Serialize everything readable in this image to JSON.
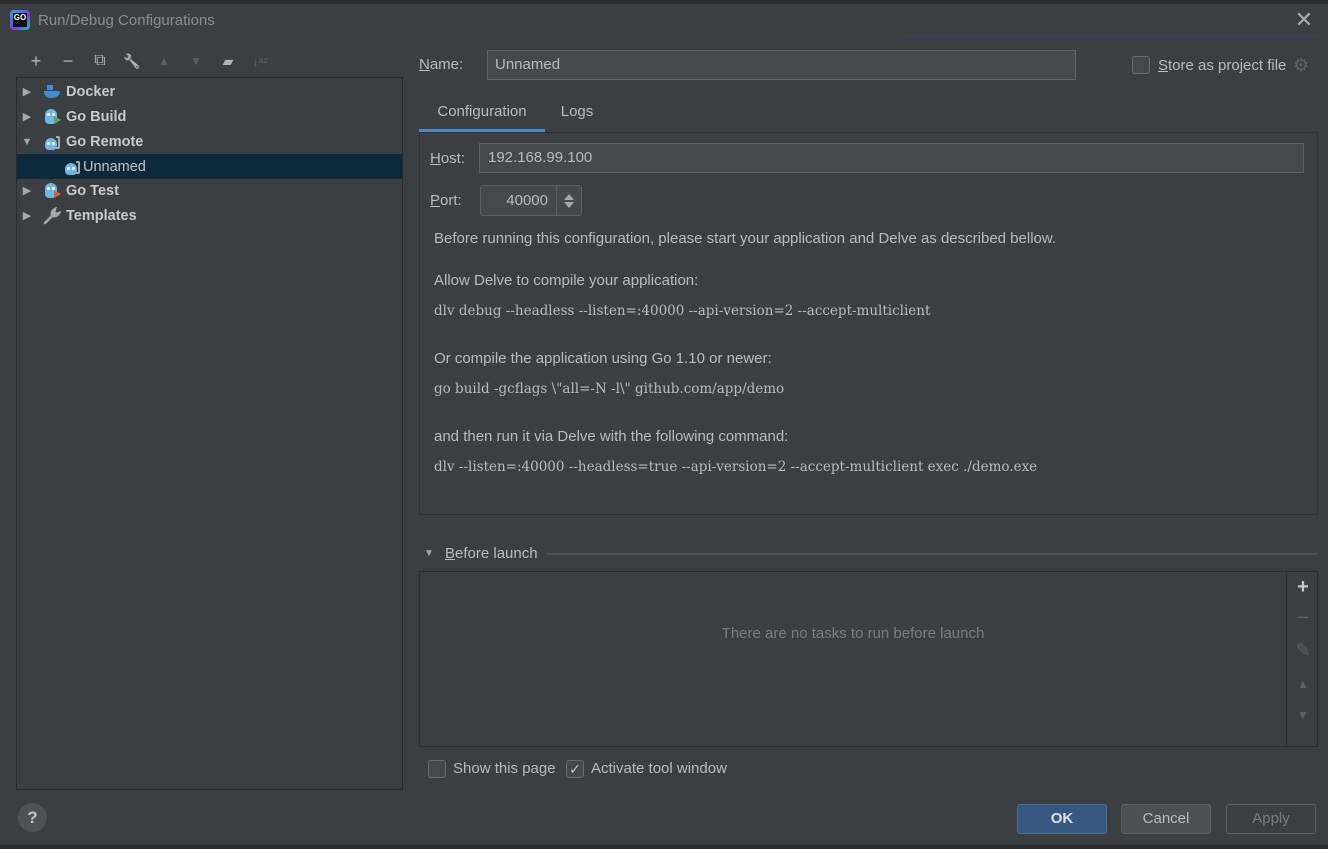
{
  "window": {
    "title": "Run/Debug Configurations",
    "app_icon": "goland-logo-icon",
    "close_icon": "close-icon"
  },
  "toolbar": {
    "buttons": [
      {
        "name": "add",
        "icon": "plus-icon",
        "glyph": "+",
        "enabled": true
      },
      {
        "name": "remove",
        "icon": "minus-icon",
        "glyph": "−",
        "enabled": true
      },
      {
        "name": "copy",
        "icon": "copy-icon",
        "glyph": "⧉",
        "enabled": true
      },
      {
        "name": "edit-defaults",
        "icon": "wrench-icon",
        "glyph": "🔧",
        "enabled": true
      },
      {
        "name": "move-up",
        "icon": "arrow-up-icon",
        "glyph": "▲",
        "enabled": false
      },
      {
        "name": "move-down",
        "icon": "arrow-down-icon",
        "glyph": "▼",
        "enabled": false
      },
      {
        "name": "new-folder",
        "icon": "folder-add-icon",
        "glyph": "▰",
        "enabled": true
      },
      {
        "name": "sort",
        "icon": "sort-alpha-icon",
        "glyph": "↓ᵃᶻ",
        "enabled": false
      }
    ]
  },
  "tree": {
    "items": [
      {
        "label": "Docker",
        "expanded": false,
        "arrow": "▶",
        "icon": "docker-icon"
      },
      {
        "label": "Go Build",
        "expanded": false,
        "arrow": "▶",
        "icon": "go-build-icon"
      },
      {
        "label": "Go Remote",
        "expanded": true,
        "arrow": "▼",
        "icon": "go-remote-icon"
      },
      {
        "label": "Unnamed",
        "child": true,
        "selected": true,
        "icon": "go-remote-icon"
      },
      {
        "label": "Go Test",
        "expanded": false,
        "arrow": "▶",
        "icon": "go-test-icon"
      },
      {
        "label": "Templates",
        "expanded": false,
        "arrow": "▶",
        "icon": "wrench-icon"
      }
    ]
  },
  "form": {
    "name_label_mnemonic": "N",
    "name_label_rest": "ame:",
    "name_value": "Unnamed",
    "store_label_mnemonic": "S",
    "store_label_rest": "tore as project file",
    "store_checked": false
  },
  "tabs": [
    {
      "label": "Configuration",
      "active": true
    },
    {
      "label": "Logs",
      "active": false
    }
  ],
  "config": {
    "host_label_mnemonic": "H",
    "host_label_rest": "ost:",
    "host_value": "192.168.99.100",
    "port_label_mnemonic": "P",
    "port_label_rest": "ort:",
    "port_value": "40000",
    "intro": "Before running this configuration, please start your application and Delve as described bellow.",
    "step1": "Allow Delve to compile your application:",
    "cmd1": "dlv debug --headless --listen=:40000 --api-version=2 --accept-multiclient",
    "step2": "Or compile the application using Go 1.10 or newer:",
    "cmd2": "go build -gcflags \\\"all=-N -l\\\" github.com/app/demo",
    "step3": "and then run it via Delve with the following command:",
    "cmd3": "dlv --listen=:40000 --headless=true --api-version=2 --accept-multiclient exec ./demo.exe"
  },
  "before_launch": {
    "label_mnemonic": "B",
    "label_rest": "efore launch",
    "empty_text": "There are no tasks to run before launch",
    "side_buttons": [
      {
        "icon": "plus-icon",
        "glyph": "+",
        "enabled": true
      },
      {
        "icon": "minus-icon",
        "glyph": "−",
        "enabled": false
      },
      {
        "icon": "pencil-icon",
        "glyph": "✎",
        "enabled": false
      },
      {
        "icon": "arrow-up-icon",
        "glyph": "▲",
        "enabled": false
      },
      {
        "icon": "arrow-down-icon",
        "glyph": "▼",
        "enabled": false
      }
    ]
  },
  "options": {
    "show_page_label": "Show this page",
    "show_page_checked": false,
    "activate_tool_label": "Activate tool window",
    "activate_tool_checked": true
  },
  "buttons": {
    "help": "?",
    "ok": "OK",
    "cancel": "Cancel",
    "apply": "Apply",
    "apply_enabled": false
  },
  "colors": {
    "background": "#3c3f41",
    "selection": "#0d293e",
    "accent": "#4a88c7",
    "ok_button": "#365880"
  }
}
